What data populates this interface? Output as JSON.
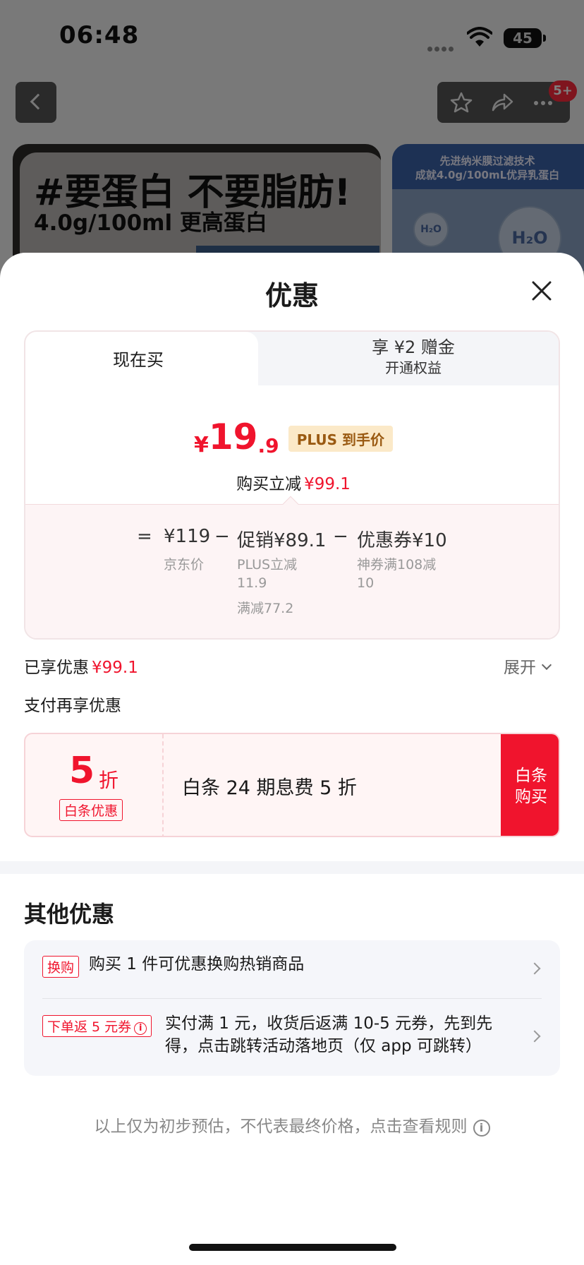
{
  "status": {
    "time": "06:48",
    "battery": "45"
  },
  "nav": {
    "badge": "5+"
  },
  "banner": {
    "headline": "#要蛋白 不要脂肪!",
    "sub": "4.0g/100ml  更高蛋白",
    "side_line1": "先进纳米膜过滤技术",
    "side_line2": "成就4.0g/100mL优异乳蛋白",
    "bubble_small": "H₂O",
    "bubble_large": "H₂O"
  },
  "sheet": {
    "title": "优惠",
    "tabs": {
      "now": "现在买",
      "gift_main": "享 ¥2 赠金",
      "gift_sub": "开通权益"
    },
    "price": {
      "yen": "¥",
      "int": "19",
      "dec": ".9",
      "tag": "PLUS 到手价"
    },
    "reduce": {
      "label": "购买立减",
      "amount": "¥99.1"
    },
    "calc": {
      "eq": "=",
      "base": "¥119",
      "base_label": "京东价",
      "minus1": "−",
      "promo": "促销¥89.1",
      "promo_sub1": "PLUS立减",
      "promo_sub2": "11.9",
      "promo_sub3": "满减77.2",
      "minus2": "−",
      "coupon": "优惠券¥10",
      "coupon_sub1": "神券满108减",
      "coupon_sub2": "10"
    },
    "enjoyed": {
      "label": "已享优惠",
      "amount": "¥99.1",
      "expand": "展开"
    },
    "pay_title": "支付再享优惠",
    "baitiao": {
      "five": "5",
      "zhe": "折",
      "tag": "白条优惠",
      "desc": "白条 24 期息费 5 折",
      "buy_line1": "白条",
      "buy_line2": "购买"
    },
    "other_title": "其他优惠",
    "other": [
      {
        "tag": "换购",
        "text": "购买 1 件可优惠换购热销商品"
      },
      {
        "tag": "下单返 5 元券",
        "info": "i",
        "text_line1": "实付满 1 元，收货后返满 10-5 元券，先到先",
        "text_line2": "得，点击跳转活动落地页（仅 app 可跳转）"
      }
    ],
    "footer": "以上仅为初步预估，不代表最终价格，点击查看规则",
    "footer_info": "i"
  }
}
